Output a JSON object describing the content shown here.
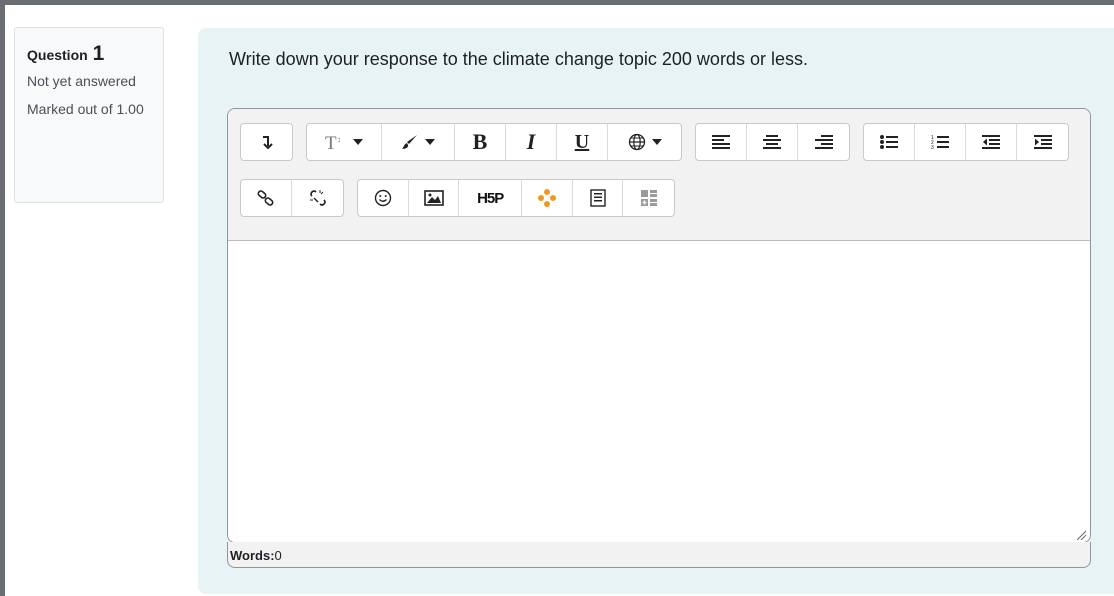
{
  "question": {
    "label": "Question",
    "number": "1",
    "state": "Not yet answered",
    "grade": "Marked out of 1.00"
  },
  "prompt": "Write down your response to the climate change topic 200 words or less.",
  "toolbar": {
    "row1": [
      {
        "name": "show-more-icon"
      },
      {
        "name": "font-size-icon"
      },
      {
        "name": "text-color-icon"
      },
      {
        "name": "bold-icon",
        "glyph": "B"
      },
      {
        "name": "italic-icon",
        "glyph": "I"
      },
      {
        "name": "underline-icon",
        "glyph": "U"
      },
      {
        "name": "language-icon"
      },
      {
        "name": "align-left-icon"
      },
      {
        "name": "align-center-icon"
      },
      {
        "name": "align-right-icon"
      },
      {
        "name": "unordered-list-icon"
      },
      {
        "name": "ordered-list-icon"
      },
      {
        "name": "outdent-icon"
      },
      {
        "name": "indent-icon"
      }
    ],
    "row2": [
      {
        "name": "link-icon"
      },
      {
        "name": "unlink-icon"
      },
      {
        "name": "emoji-icon"
      },
      {
        "name": "image-icon"
      },
      {
        "name": "h5p-icon",
        "glyph": "H5P"
      },
      {
        "name": "plugin-icon"
      },
      {
        "name": "template-icon"
      },
      {
        "name": "table-icon"
      }
    ]
  },
  "wordcount": {
    "label": "Words:",
    "value": "0"
  }
}
